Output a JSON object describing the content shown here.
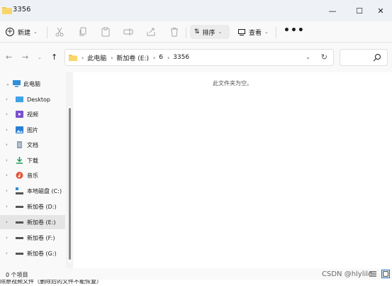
{
  "window": {
    "title": "3356",
    "controls": {
      "minimize": "—",
      "maximize": "☐",
      "close": "✕"
    }
  },
  "toolbar": {
    "new_label": "新建",
    "sort_label": "排序",
    "view_label": "查看",
    "more_label": "•••",
    "disabled_icons": [
      "cut-icon",
      "copy-icon",
      "paste-icon",
      "rename-icon",
      "share-icon",
      "delete-icon"
    ]
  },
  "address": {
    "crumbs": [
      "此电脑",
      "新加卷 (E:)",
      "6",
      "3356"
    ],
    "search_placeholder": ""
  },
  "sidebar": {
    "items": [
      {
        "label": "此电脑",
        "icon": "computer-icon",
        "expanded": true
      },
      {
        "label": "Desktop",
        "icon": "desktop-icon"
      },
      {
        "label": "视频",
        "icon": "videos-icon"
      },
      {
        "label": "图片",
        "icon": "pictures-icon"
      },
      {
        "label": "文档",
        "icon": "documents-icon"
      },
      {
        "label": "下载",
        "icon": "downloads-icon"
      },
      {
        "label": "音乐",
        "icon": "music-icon"
      },
      {
        "label": "本地磁盘 (C:)",
        "icon": "system-drive-icon"
      },
      {
        "label": "新加卷 (D:)",
        "icon": "drive-icon"
      },
      {
        "label": "新加卷 (E:)",
        "icon": "drive-icon",
        "selected": true
      },
      {
        "label": "新加卷 (F:)",
        "icon": "drive-icon"
      },
      {
        "label": "新加卷 (G:)",
        "icon": "drive-icon"
      }
    ]
  },
  "content": {
    "empty_message": "此文件夹为空。"
  },
  "status": {
    "item_count": "0 个项目"
  },
  "underlying_text": "除原视频文件（删除后的文件不能恢复）",
  "watermark": "CSDN @hlylile",
  "colors": {
    "folder": "#f4c84a",
    "accent": "#1b6ac9",
    "selected_bg": "#e5e5e5"
  }
}
